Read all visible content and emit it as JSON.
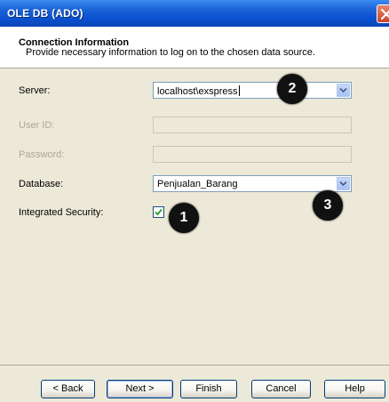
{
  "window": {
    "title": "OLE DB (ADO)"
  },
  "header": {
    "title": "Connection Information",
    "subtitle": "Provide necessary information to log on to the chosen data source."
  },
  "fields": {
    "server": {
      "label": "Server:",
      "value": "localhost\\exspress"
    },
    "user_id": {
      "label": "User ID:",
      "value": ""
    },
    "password": {
      "label": "Password:",
      "value": ""
    },
    "database": {
      "label": "Database:",
      "value": "Penjualan_Barang"
    },
    "integrated_security": {
      "label": "Integrated Security:",
      "checked": true
    }
  },
  "markers": {
    "one": "1",
    "two": "2",
    "three": "3"
  },
  "buttons": {
    "back": "< Back",
    "next": "Next >",
    "finish": "Finish",
    "cancel": "Cancel",
    "help": "Help"
  },
  "colors": {
    "title_bar": "#0a50cf",
    "dialog_bg": "#ece9d8",
    "close_button": "#c8482c"
  },
  "icons": {
    "close": "close-icon",
    "dropdown": "chevron-down-icon",
    "check": "check-icon"
  }
}
